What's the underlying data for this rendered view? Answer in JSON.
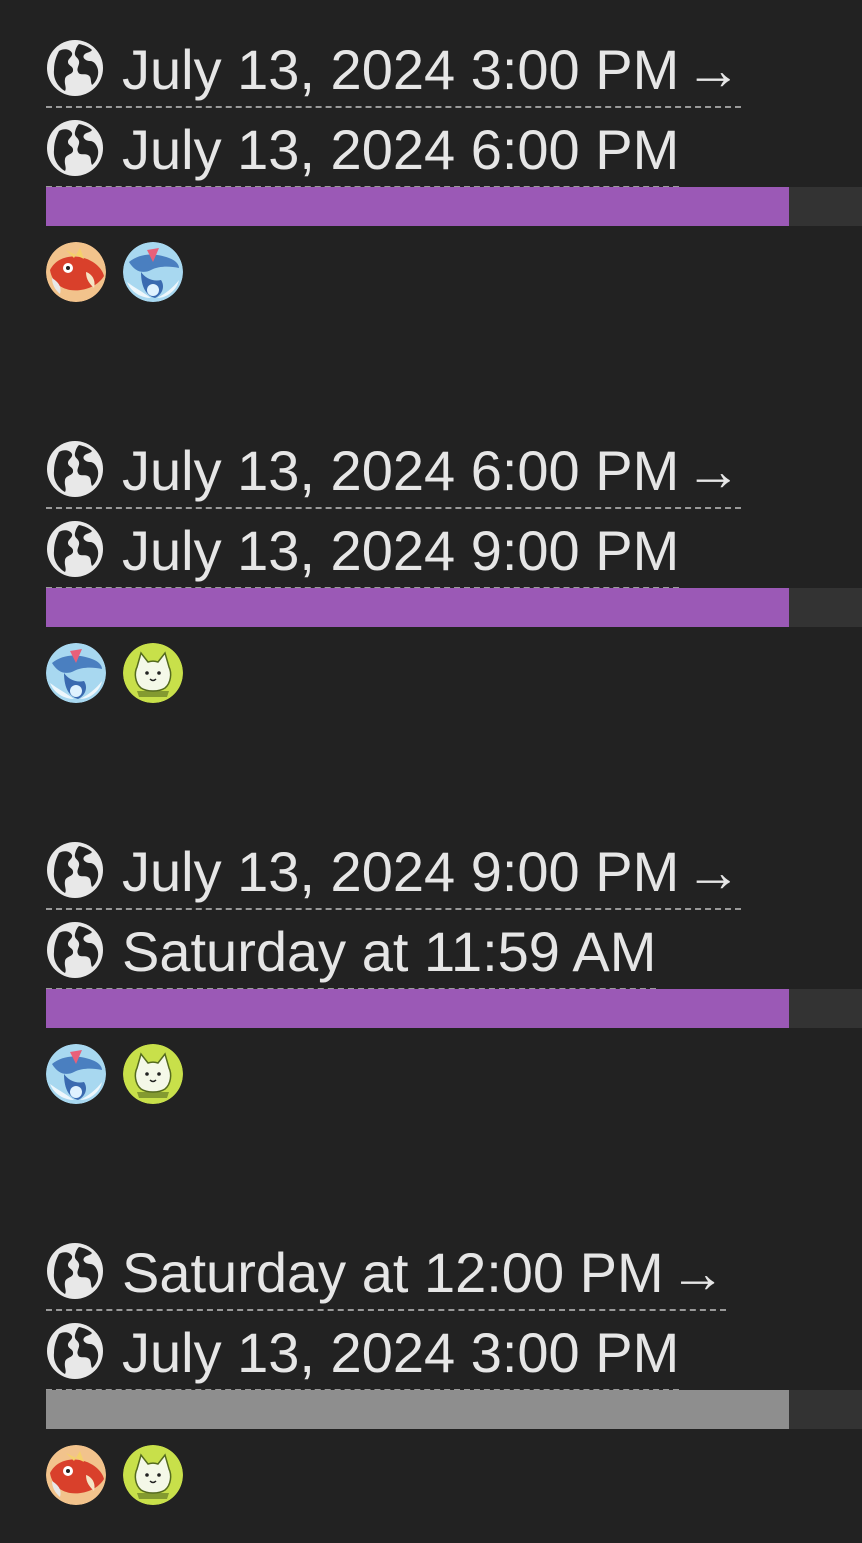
{
  "arrow": "→",
  "events": [
    {
      "start": "July 13, 2024 3:00 PM",
      "end": "July 13, 2024 6:00 PM",
      "progress_percent": 100,
      "bar_color": "#9b59b6",
      "icons": [
        "magikarp-icon",
        "gyarados-icon"
      ]
    },
    {
      "start": "July 13, 2024 6:00 PM",
      "end": "July 13, 2024 9:00 PM",
      "progress_percent": 100,
      "bar_color": "#9b59b6",
      "icons": [
        "gyarados-icon",
        "battle-cat-icon"
      ]
    },
    {
      "start": "July 13, 2024 9:00 PM",
      "end": "Saturday at 11:59 AM",
      "progress_percent": 100,
      "bar_color": "#9b59b6",
      "icons": [
        "gyarados-icon",
        "battle-cat-icon"
      ]
    },
    {
      "start": "Saturday at 12:00 PM",
      "end": "July 13, 2024 3:00 PM",
      "progress_percent": 100,
      "bar_color": "#8e8e8e",
      "icons": [
        "magikarp-icon",
        "battle-cat-icon"
      ]
    }
  ]
}
